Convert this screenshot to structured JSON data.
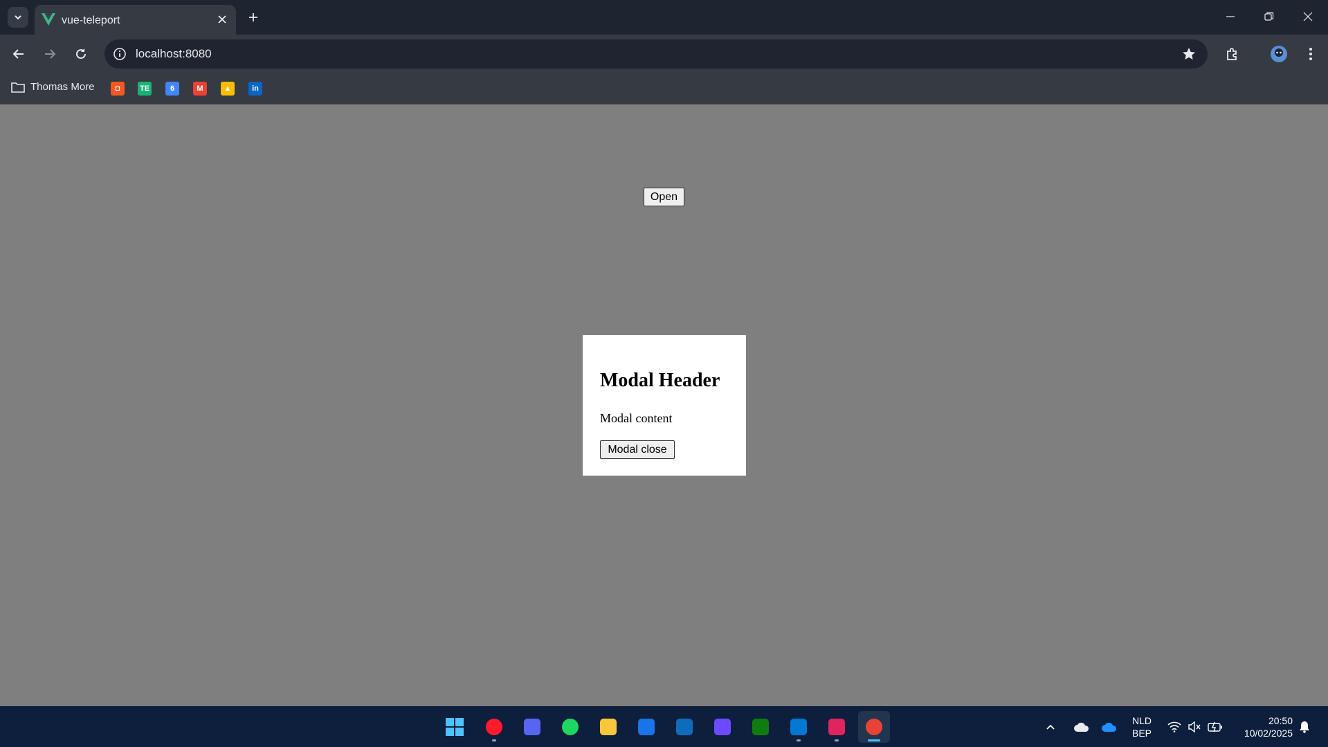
{
  "browser": {
    "tab": {
      "title": "vue-teleport",
      "favicon": "vue-logo-icon"
    },
    "address_bar": {
      "url": "localhost:8080"
    },
    "bookmarks": {
      "folder_label": "Thomas More",
      "items": [
        {
          "name": "orange-app-icon",
          "glyph": "◘",
          "color": "#f05a22"
        },
        {
          "name": "te-icon",
          "glyph": "TE",
          "color": "#18b374"
        },
        {
          "name": "calendar-icon",
          "glyph": "6",
          "color": "#4285f4"
        },
        {
          "name": "gmail-icon",
          "glyph": "M",
          "color": "#ea4335"
        },
        {
          "name": "google-drive-icon",
          "glyph": "▲",
          "color": "#fbbc04"
        },
        {
          "name": "linkedin-icon",
          "glyph": "in",
          "color": "#0a66c2"
        }
      ]
    }
  },
  "page": {
    "open_button_label": "Open",
    "modal": {
      "header": "Modal Header",
      "content": "Modal content",
      "close_button_label": "Modal close"
    }
  },
  "taskbar": {
    "apps": [
      {
        "name": "windows-start-icon",
        "color": "#4cc2ff"
      },
      {
        "name": "opera-icon",
        "color": "#ff1b2d"
      },
      {
        "name": "discord-icon",
        "color": "#5865f2"
      },
      {
        "name": "spotify-icon",
        "color": "#1ed760"
      },
      {
        "name": "file-explorer-icon",
        "color": "#f8c83a"
      },
      {
        "name": "calendar-app-icon",
        "color": "#1a73e8"
      },
      {
        "name": "outlook-icon",
        "color": "#0f6cbd"
      },
      {
        "name": "proton-icon",
        "color": "#6d4aff"
      },
      {
        "name": "xbox-icon",
        "color": "#107c10"
      },
      {
        "name": "vscode-icon",
        "color": "#0078d4"
      },
      {
        "name": "app-icon",
        "color": "#e0245e"
      },
      {
        "name": "chrome-icon",
        "color": "#ea4335"
      }
    ],
    "language": {
      "line1": "NLD",
      "line2": "BEP"
    },
    "clock": {
      "time": "20:50",
      "date": "10/02/2025"
    }
  }
}
